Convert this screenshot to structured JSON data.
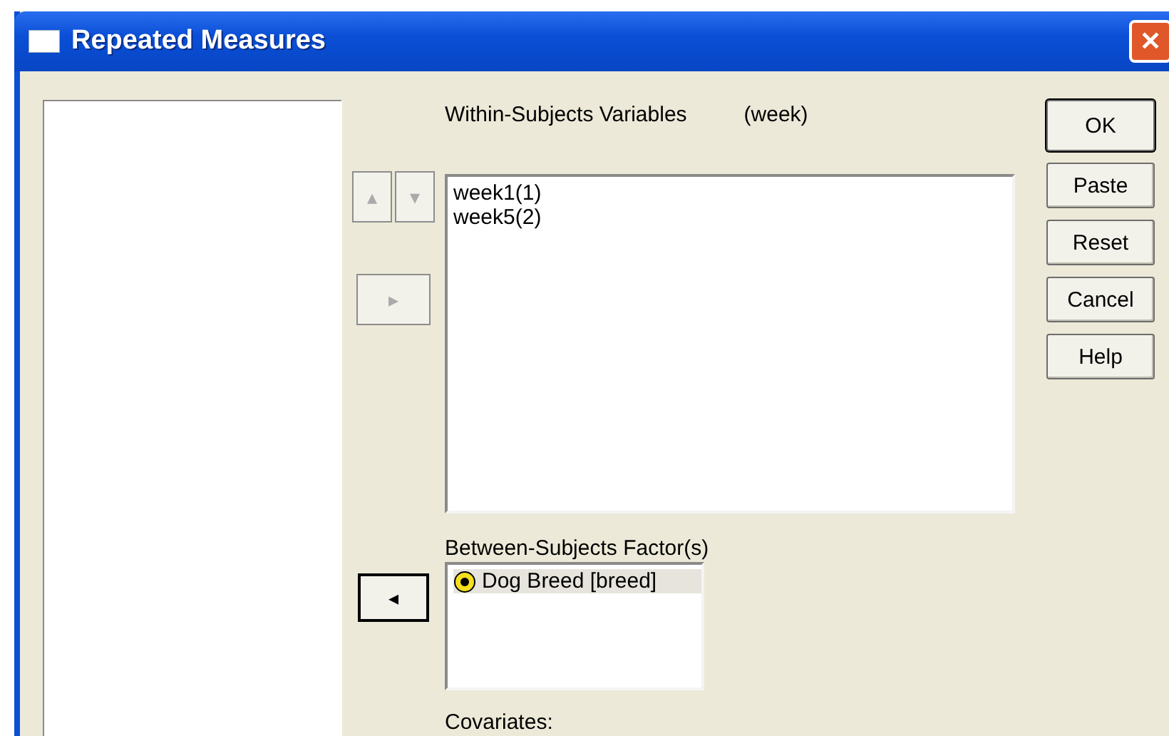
{
  "window": {
    "title": "Repeated Measures",
    "close_label": "✕"
  },
  "within": {
    "label": "Within-Subjects Variables",
    "factor": "(week)",
    "items": [
      {
        "label": "week1(1)",
        "selected": false
      },
      {
        "label": "week5(2)",
        "selected": false
      }
    ]
  },
  "move_buttons": [
    {
      "label": "▴",
      "disabled": true
    },
    {
      "label": "▾",
      "disabled": true
    }
  ],
  "arrow_within": {
    "label": "▸",
    "disabled": true
  },
  "between": {
    "label": "Between-Subjects Factor(s)",
    "items": [
      {
        "label": "Dog Breed [breed]",
        "selected": true
      }
    ]
  },
  "arrow_between": {
    "label": "◂",
    "disabled": false
  },
  "covariates": {
    "label": "Covariates:"
  },
  "buttons": [
    {
      "label": "OK",
      "default": true
    },
    {
      "label": "Paste",
      "default": false
    },
    {
      "label": "Reset",
      "default": false
    },
    {
      "label": "Cancel",
      "default": false
    },
    {
      "label": "Help",
      "default": false
    }
  ]
}
